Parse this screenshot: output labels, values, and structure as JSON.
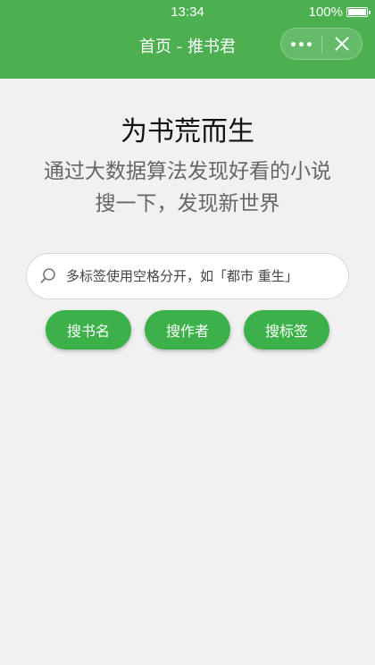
{
  "status_bar": {
    "time": "13:34",
    "battery": "100%"
  },
  "nav": {
    "title": "首页 - 推书君"
  },
  "hero": {
    "title": "为书荒而生",
    "line1": "通过大数据算法发现好看的小说",
    "line2": "搜一下，发现新世界"
  },
  "search": {
    "placeholder": "多标签使用空格分开，如「都市 重生」"
  },
  "buttons": {
    "by_title": "搜书名",
    "by_author": "搜作者",
    "by_tag": "搜标签"
  },
  "colors": {
    "header": "#4caf50",
    "button": "#3cb14a",
    "background": "#f1f1f1"
  }
}
